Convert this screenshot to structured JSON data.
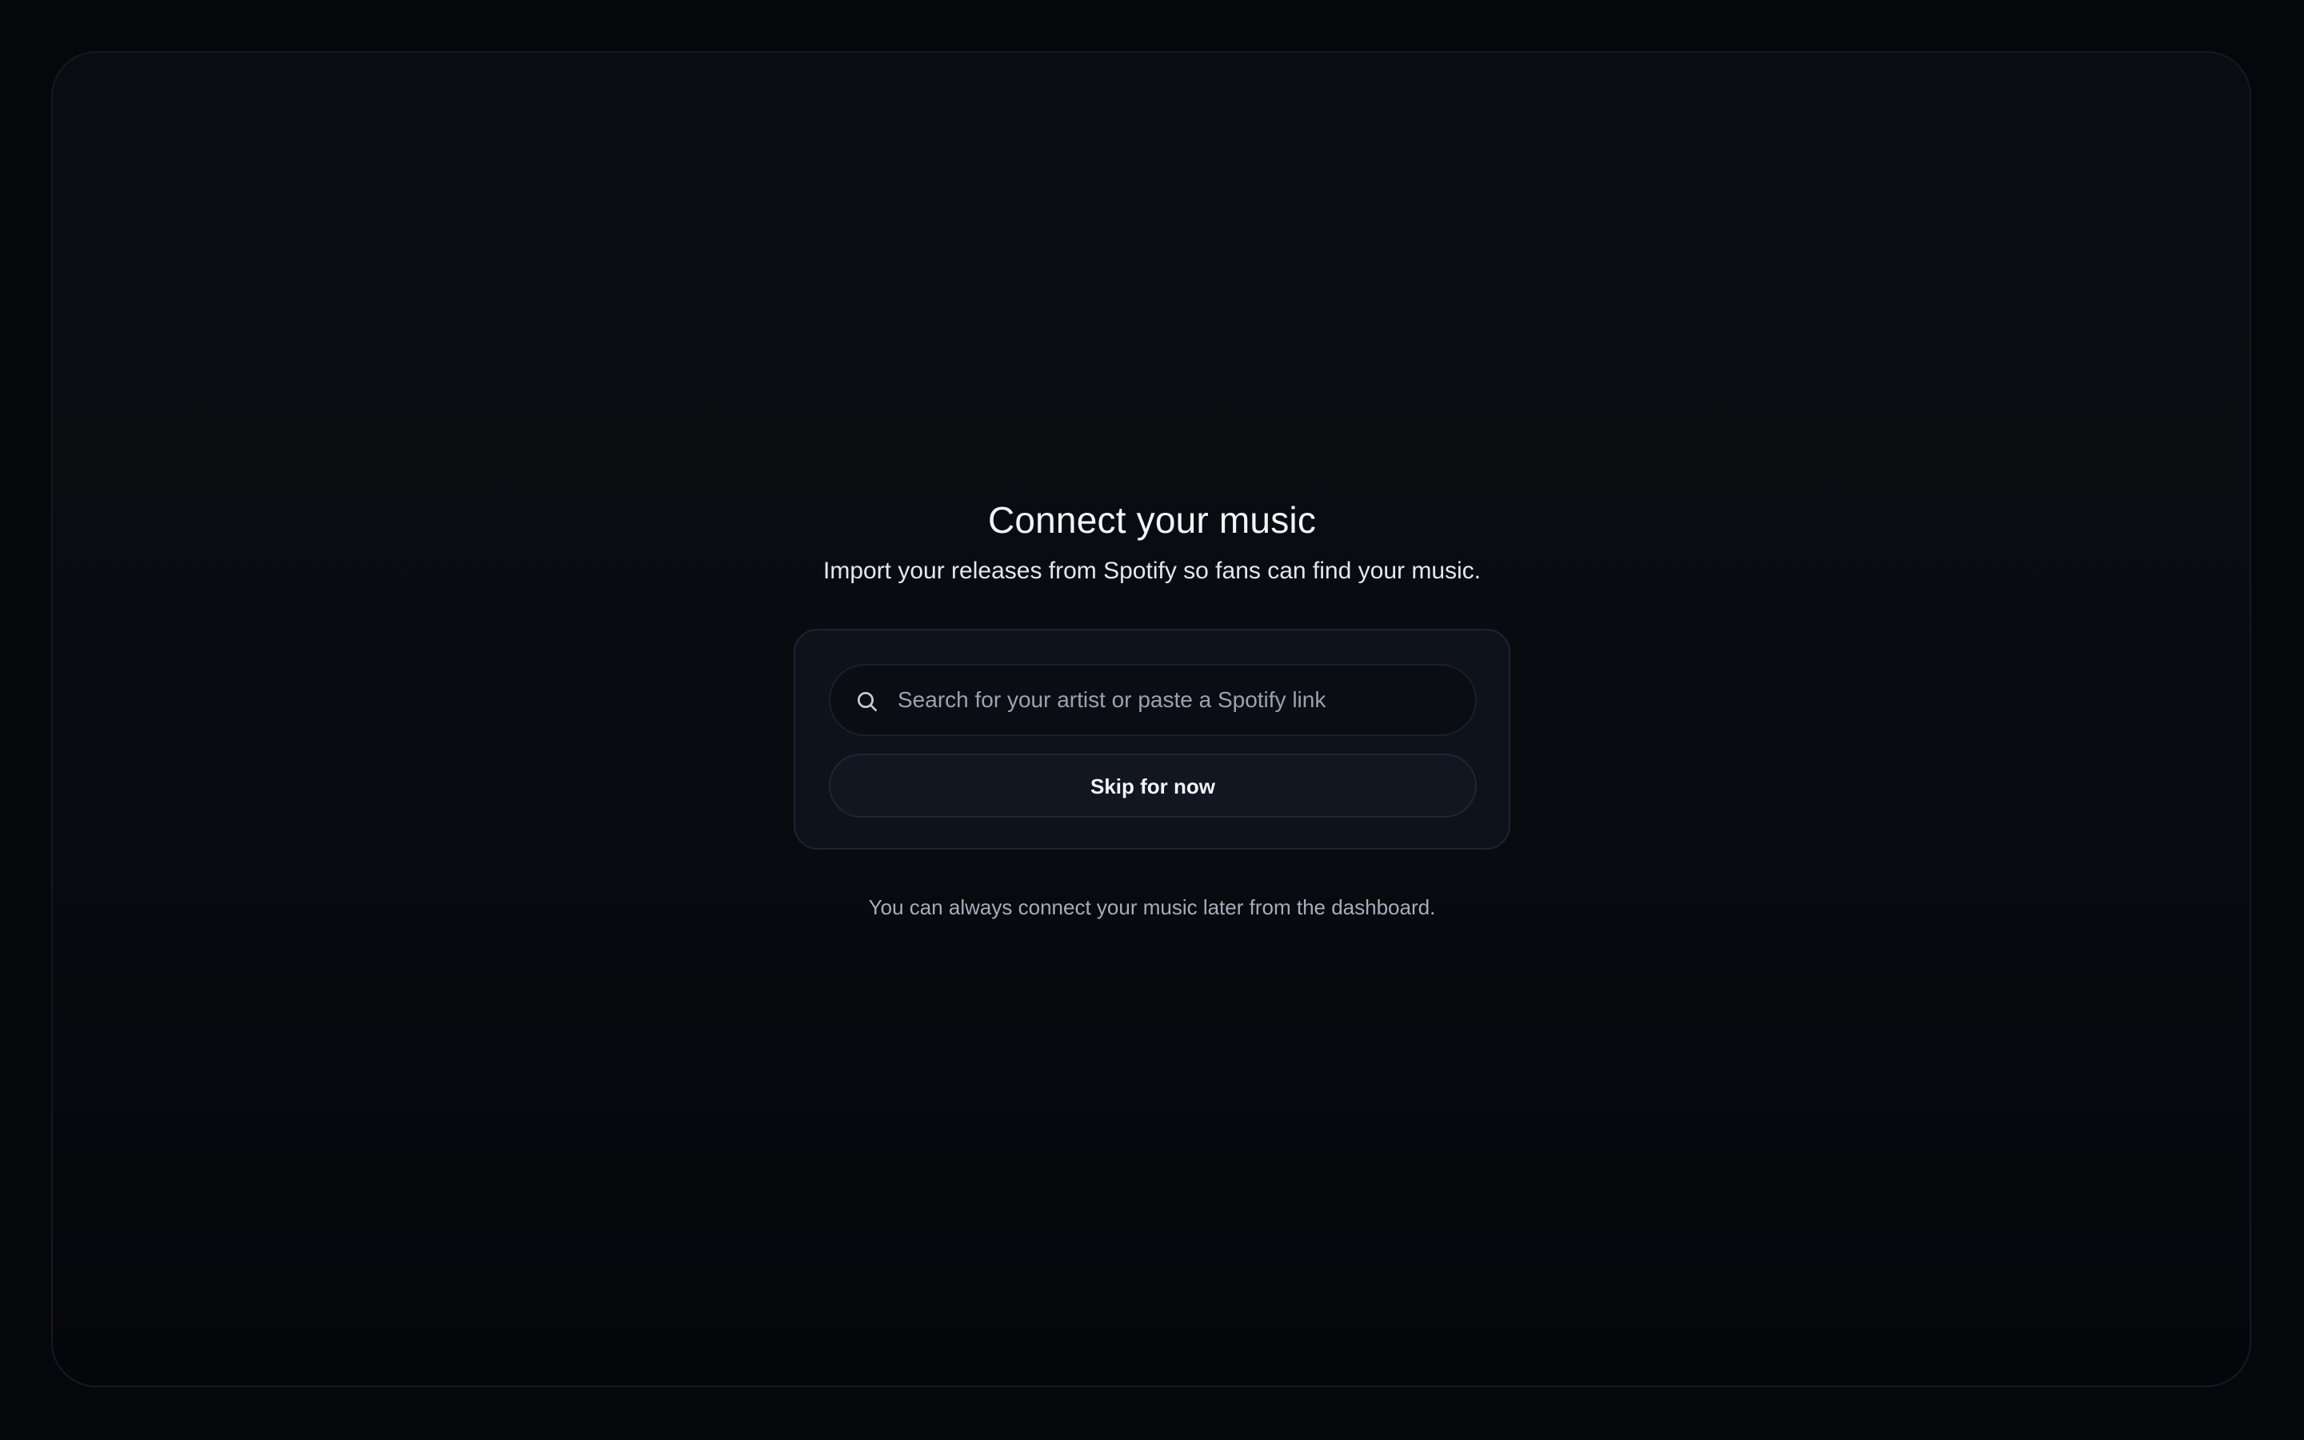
{
  "onboarding": {
    "title": "Connect your music",
    "subtitle": "Import your releases from Spotify so fans can find your music.",
    "search": {
      "placeholder": "Search for your artist or paste a Spotify link",
      "value": "",
      "icon": "search-icon"
    },
    "skip_label": "Skip for now",
    "footnote": "You can always connect your music later from the dashboard."
  },
  "colors": {
    "background": "#06070b",
    "card": "#0e121b",
    "text_primary": "#f2f4f8",
    "text_muted": "#a6adba"
  }
}
